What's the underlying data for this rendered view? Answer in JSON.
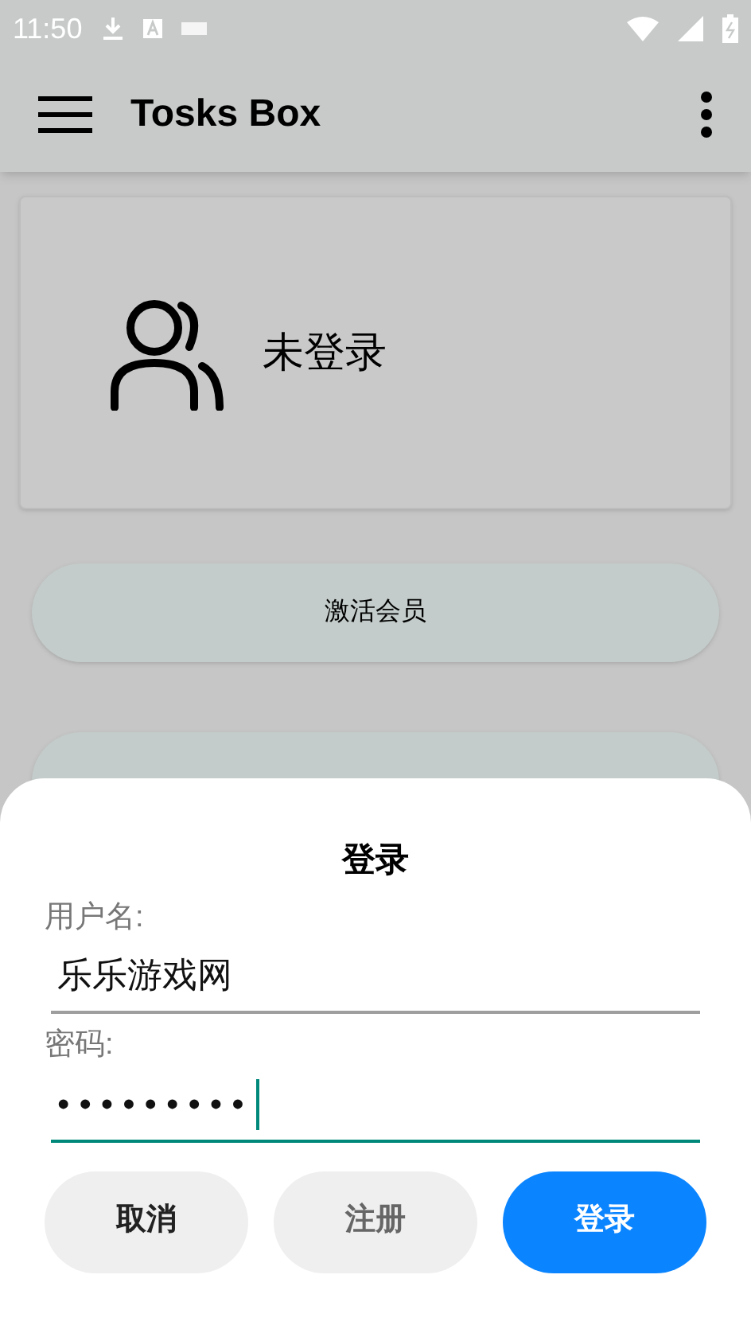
{
  "status_bar": {
    "time": "11:50"
  },
  "app_bar": {
    "title": "Tosks Box"
  },
  "account_card": {
    "status": "未登录"
  },
  "member_buttons": [
    {
      "label": "激活会员",
      "kind": "labeled"
    },
    {
      "kind": "covered"
    }
  ],
  "login_dialog": {
    "title": "登录",
    "fields": [
      {
        "label": "用户名:",
        "value": "乐乐游戏网",
        "focused": false
      },
      {
        "label": "密码:",
        "value": "•••••••••",
        "focused": true
      }
    ],
    "buttons": [
      {
        "label": "取消",
        "kind": "plain"
      },
      {
        "label": "注册",
        "kind": "muted"
      },
      {
        "label": "登录",
        "kind": "primary"
      }
    ]
  }
}
